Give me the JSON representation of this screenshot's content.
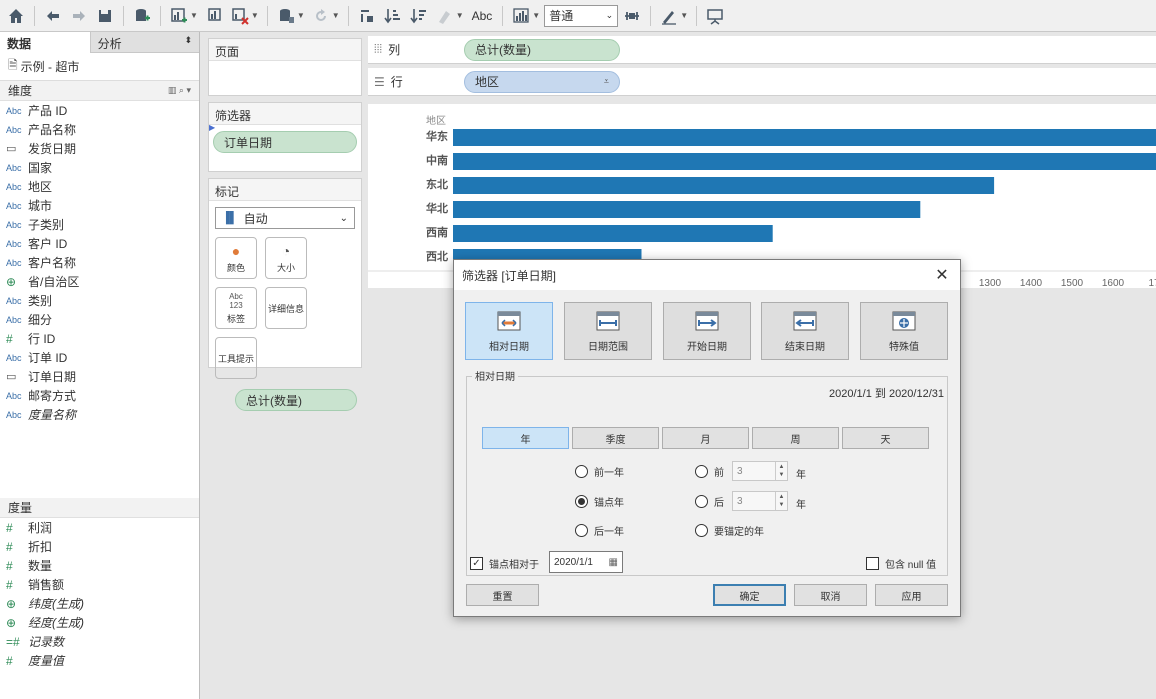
{
  "toolbar": {
    "mark_format_select": "普通",
    "abc_label": "Abc"
  },
  "left_pane": {
    "tab_data": "数据",
    "tab_analysis": "分析",
    "tab_analysis_caret": "⬍",
    "datasource": "示例 - 超市",
    "dimensions_header": "维度",
    "dimensions": [
      {
        "type": "Abc",
        "label": "产品 ID"
      },
      {
        "type": "Abc",
        "label": "产品名称"
      },
      {
        "type": "date",
        "label": "发货日期"
      },
      {
        "type": "Abc",
        "label": "国家"
      },
      {
        "type": "Abc",
        "label": "地区"
      },
      {
        "type": "Abc",
        "label": "城市"
      },
      {
        "type": "Abc",
        "label": "子类别"
      },
      {
        "type": "Abc",
        "label": "客户 ID"
      },
      {
        "type": "Abc",
        "label": "客户名称"
      },
      {
        "type": "geo",
        "label": "省/自治区"
      },
      {
        "type": "Abc",
        "label": "类别"
      },
      {
        "type": "Abc",
        "label": "细分"
      },
      {
        "type": "#",
        "label": "行 ID"
      },
      {
        "type": "Abc",
        "label": "订单 ID"
      },
      {
        "type": "date",
        "label": "订单日期"
      },
      {
        "type": "Abc",
        "label": "邮寄方式"
      },
      {
        "type": "Abc",
        "label": "度量名称"
      }
    ],
    "measures_header": "度量",
    "measures": [
      {
        "type": "#",
        "label": "利润"
      },
      {
        "type": "#",
        "label": "折扣"
      },
      {
        "type": "#",
        "label": "数量"
      },
      {
        "type": "#",
        "label": "销售额"
      },
      {
        "type": "geo",
        "label": "纬度(生成)"
      },
      {
        "type": "geo",
        "label": "经度(生成)"
      },
      {
        "type": "=#",
        "label": "记录数"
      },
      {
        "type": "#",
        "label": "度量值"
      }
    ]
  },
  "shelves": {
    "pages_label": "页面",
    "filters_label": "筛选器",
    "filter_pill": "订单日期",
    "marks_label": "标记",
    "mark_type": "自动",
    "mark_buttons": [
      "颜色",
      "大小",
      "标签",
      "详细信息",
      "工具提示"
    ],
    "label_icon_text": "Abc\n123",
    "marks_pill": "总计(数量)",
    "columns_label": "列",
    "columns_pill": "总计(数量)",
    "rows_label": "行",
    "rows_pill": "地区"
  },
  "chart_data": {
    "type": "bar",
    "orientation": "horizontal",
    "y_header": "地区",
    "categories": [
      "华东",
      "中南",
      "东北",
      "华北",
      "西南",
      "西北"
    ],
    "values": [
      1790,
      1790,
      1310,
      1130,
      770,
      450
    ],
    "xlim": [
      0,
      1700
    ],
    "visible_ticks": [
      "1300",
      "1400",
      "1500",
      "1600",
      "17"
    ],
    "bar_color": "#1f77b4"
  },
  "dialog": {
    "title": "筛选器 [订单日期]",
    "close": "✕",
    "modes": [
      "相对日期",
      "日期范围",
      "开始日期",
      "结束日期",
      "特殊值"
    ],
    "group_label": "相对日期",
    "range_text": "2020/1/1 到 2020/12/31",
    "units": [
      "年",
      "季度",
      "月",
      "周",
      "天"
    ],
    "opt_prev": "前一年",
    "opt_anchor": "锚点年",
    "opt_next": "后一年",
    "opt_before": "前",
    "opt_after": "后",
    "opt_todate": "要锚定的年",
    "spin_before": "3",
    "spin_after": "3",
    "year_unit": "年",
    "anchor_label": "锚点相对于",
    "anchor_date": "2020/1/1",
    "include_null": "包含 null 值",
    "btn_reset": "重置",
    "btn_ok": "确定",
    "btn_cancel": "取消",
    "btn_apply": "应用"
  }
}
